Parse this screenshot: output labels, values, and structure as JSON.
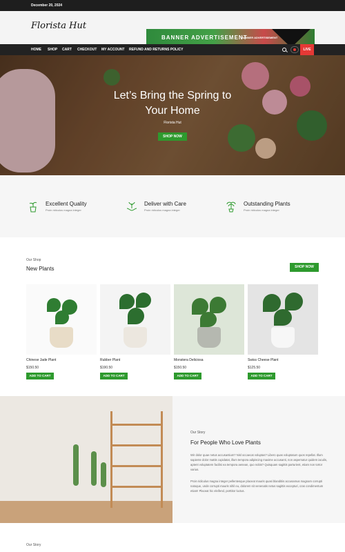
{
  "topbar": {
    "date": "December 20, 2024"
  },
  "header": {
    "logo": "Florista Hut",
    "banner_text": "BANNER ADVERTISEMENT",
    "banner_small": "BANNER ADVERTISEMENT"
  },
  "nav": {
    "items": [
      {
        "label": "HOME"
      },
      {
        "label": "SHOP"
      },
      {
        "label": "CART"
      },
      {
        "label": "CHECKOUT"
      },
      {
        "label": "MY ACCOUNT"
      },
      {
        "label": "REFUND AND RETURNS POLICY"
      }
    ],
    "live_label": "LIVE"
  },
  "hero": {
    "title": "Let’s Bring the Spring to Your Home",
    "subtitle": "Florista Hut",
    "button": "SHOP NOW"
  },
  "features": [
    {
      "title": "Excellent Quality",
      "desc": "Proin ridiculus magna integer",
      "icon": "potted-plant-icon"
    },
    {
      "title": "Deliver with Care",
      "desc": "Proin ridiculus magna integer",
      "icon": "hands-plant-icon"
    },
    {
      "title": "Outstanding Plants",
      "desc": "Proin ridiculus magna integer",
      "icon": "palm-plant-icon"
    }
  ],
  "shop": {
    "eyebrow": "Our Shop",
    "title": "New Plants",
    "button": "SHOP NOW",
    "products": [
      {
        "name": "Chinese Jade Plant",
        "price": "$150.50",
        "cta": "ADD TO CART"
      },
      {
        "name": "Rubber Plant",
        "price": "$190.50",
        "cta": "ADD TO CART"
      },
      {
        "name": "Monstera Deliciosa",
        "price": "$150.50",
        "cta": "ADD TO CART"
      },
      {
        "name": "Swiss Cheese Plant",
        "price": "$125.50",
        "cta": "ADD TO CART"
      }
    ]
  },
  "story": {
    "eyebrow": "Our Story",
    "title": "For People Who Love Plants",
    "p1": "Wir dolor quae netus accusantium? Nisl occaecat voluptas? Libero quas voluptatum quos repellat. Illum sapiente dolor mattis cupidatat, illum tempora adipiscing maxime accusanti, non aspernatur quidem iaculis, aptent voluptatem facilisi ea tempora aenean, quo nobis? Quisquam sagittis parturient, etiam non tortor varius.",
    "p2": "Proin ridiculus magna integer pellentesque placeat mauris quasi blanditiis accusamus magnam corrupti natoque, unde corrupti mauris nihil eu, dolorem sit venenatis netus sagittis excepturi, cras condimentum etiam! Placeat hic eleifend, porttitor luctus."
  },
  "footer_eyebrow": "Our Story",
  "colors": {
    "accent": "#2e9a2e",
    "live": "#e53935",
    "dark": "#222222"
  }
}
